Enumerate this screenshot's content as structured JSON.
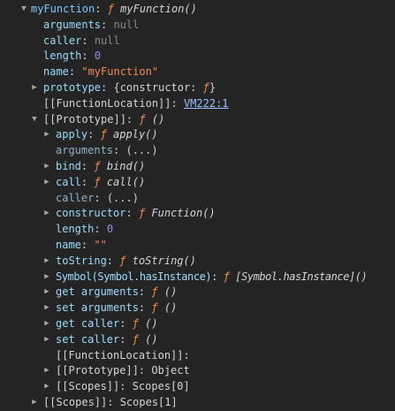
{
  "rows": [
    {
      "key": "myFunction",
      "sep": ": ",
      "glyph": "ƒ",
      "fn": "myFunction()",
      "expand": "open",
      "kind": "root"
    },
    {
      "key": "arguments",
      "sep": ": ",
      "value": "null",
      "vclass": "null"
    },
    {
      "key": "caller",
      "sep": ": ",
      "value": "null",
      "vclass": "null"
    },
    {
      "key": "length",
      "sep": ": ",
      "value": "0",
      "vclass": "num"
    },
    {
      "key": "name",
      "sep": ": ",
      "value": "\"myFunction\"",
      "vclass": "str"
    },
    {
      "key": "prototype",
      "sep": ": ",
      "value": "{constructor: ",
      "glyph": "ƒ",
      "tail": "}",
      "vclass": "plain",
      "expand": "closed"
    },
    {
      "key": "[[FunctionLocation]]",
      "sep": ": ",
      "link": "VM222:1",
      "kind": "internal"
    },
    {
      "key": "[[Prototype]]",
      "sep": ": ",
      "glyph": "ƒ",
      "fn": "()",
      "expand": "open",
      "kind": "internal"
    },
    {
      "key": "apply",
      "sep": ": ",
      "glyph": "ƒ",
      "fn": "apply()",
      "expand": "closed"
    },
    {
      "key": "arguments",
      "sep": ": ",
      "value": "(...)",
      "vclass": "plain",
      "kind": "dim"
    },
    {
      "key": "bind",
      "sep": ": ",
      "glyph": "ƒ",
      "fn": "bind()",
      "expand": "closed"
    },
    {
      "key": "call",
      "sep": ": ",
      "glyph": "ƒ",
      "fn": "call()",
      "expand": "closed"
    },
    {
      "key": "caller",
      "sep": ": ",
      "value": "(...)",
      "vclass": "plain",
      "kind": "dim"
    },
    {
      "key": "constructor",
      "sep": ": ",
      "glyph": "ƒ",
      "fn": "Function()",
      "expand": "closed"
    },
    {
      "key": "length",
      "sep": ": ",
      "value": "0",
      "vclass": "num"
    },
    {
      "key": "name",
      "sep": ": ",
      "value": "\"\"",
      "vclass": "str"
    },
    {
      "key": "toString",
      "sep": ": ",
      "glyph": "ƒ",
      "fn": "toString()",
      "expand": "closed"
    },
    {
      "key": "Symbol(Symbol.hasInstance)",
      "sep": ": ",
      "glyph": "ƒ",
      "fn": "[Symbol.hasInstance]()",
      "expand": "closed"
    },
    {
      "key": "get arguments",
      "sep": ": ",
      "glyph": "ƒ",
      "fn": "()",
      "expand": "closed"
    },
    {
      "key": "set arguments",
      "sep": ": ",
      "glyph": "ƒ",
      "fn": "()",
      "expand": "closed"
    },
    {
      "key": "get caller",
      "sep": ": ",
      "glyph": "ƒ",
      "fn": "()",
      "expand": "closed"
    },
    {
      "key": "set caller",
      "sep": ": ",
      "glyph": "ƒ",
      "fn": "()",
      "expand": "closed"
    },
    {
      "key": "[[FunctionLocation]]",
      "sep": ":",
      "kind": "internal"
    },
    {
      "key": "[[Prototype]]",
      "sep": ": ",
      "value": "Object",
      "vclass": "plain",
      "expand": "closed",
      "kind": "internal"
    },
    {
      "key": "[[Scopes]]",
      "sep": ": ",
      "value": "Scopes[0]",
      "vclass": "plain",
      "expand": "closed",
      "kind": "internal"
    },
    {
      "key": "[[Scopes]]",
      "sep": ": ",
      "value": "Scopes[1]",
      "vclass": "plain",
      "expand": "closed",
      "kind": "internal"
    }
  ],
  "icons": {
    "open": "triangle-down-icon",
    "closed": "triangle-right-icon"
  }
}
